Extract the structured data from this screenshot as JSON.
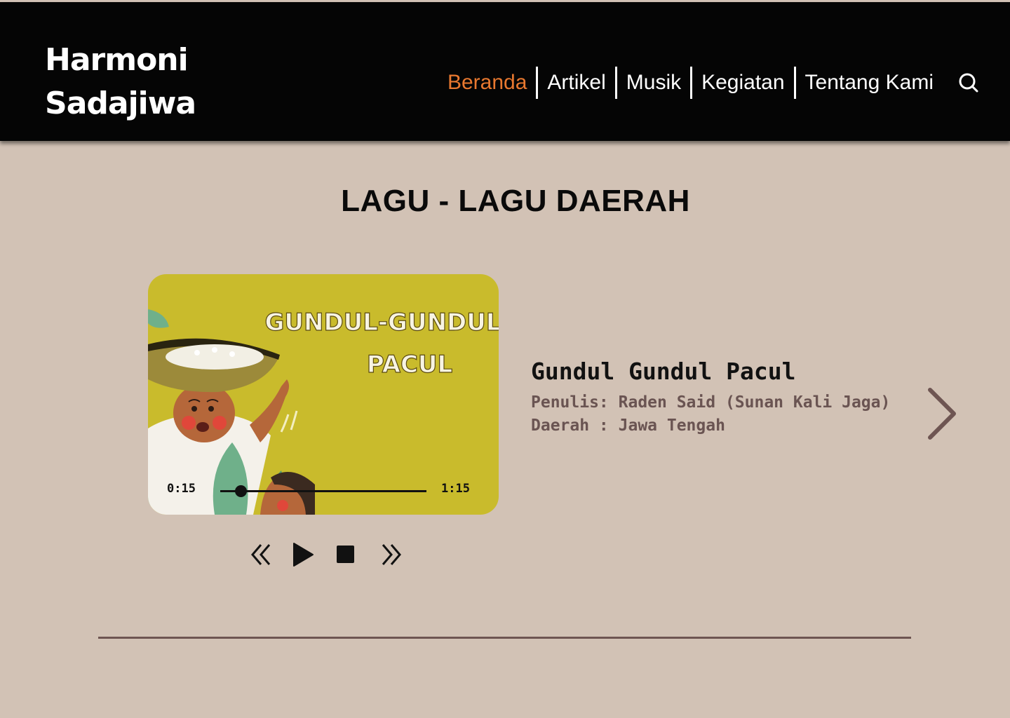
{
  "header": {
    "logo_line1": "Harmoni",
    "logo_line2": "Sadajiwa",
    "nav": [
      {
        "label": "Beranda",
        "active": true
      },
      {
        "label": "Artikel",
        "active": false
      },
      {
        "label": "Musik",
        "active": false
      },
      {
        "label": "Kegiatan",
        "active": false
      },
      {
        "label": "Tentang Kami",
        "active": false
      }
    ],
    "search_icon": "search-icon"
  },
  "section": {
    "title": "LAGU - LAGU DAERAH"
  },
  "player": {
    "cover_title_line1": "GUNDUL-GUNDUL",
    "cover_title_line2": "PACUL",
    "current_time": "0:15",
    "duration": "1:15",
    "progress": 0.1,
    "controls": [
      "rewind-icon",
      "play-icon",
      "stop-icon",
      "fast-forward-icon"
    ]
  },
  "song": {
    "title": "Gundul Gundul Pacul",
    "writer": "Penulis: Raden Said (Sunan Kali Jaga)",
    "region": "Daerah : Jawa Tengah",
    "next_icon": "chevron-right-icon"
  },
  "colors": {
    "background": "#d2c2b5",
    "header": "#050505",
    "accent": "#e8782f",
    "meta_text": "#6a5452",
    "divider": "#6e5552",
    "cover_bg": "#c9bb2c"
  }
}
